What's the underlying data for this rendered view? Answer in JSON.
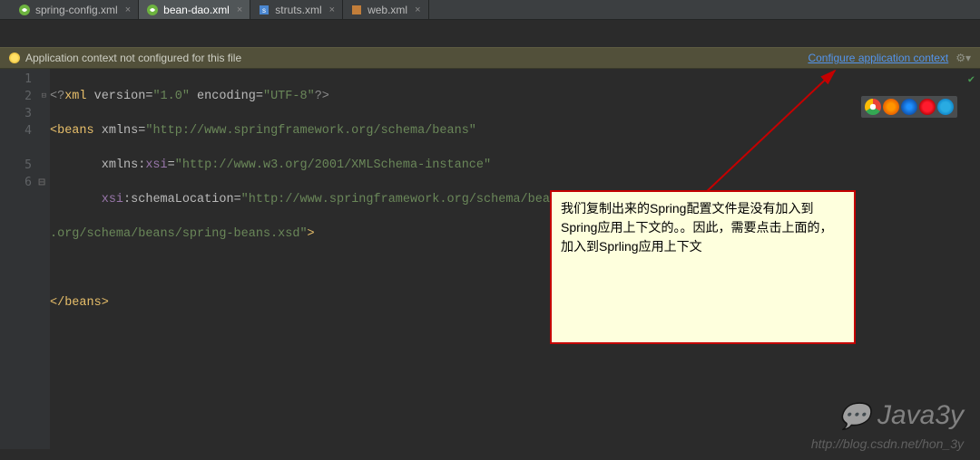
{
  "tabs": [
    {
      "label": "spring-config.xml",
      "active": false,
      "icon": "spring"
    },
    {
      "label": "bean-dao.xml",
      "active": true,
      "icon": "spring"
    },
    {
      "label": "struts.xml",
      "active": false,
      "icon": "struts"
    },
    {
      "label": "web.xml",
      "active": false,
      "icon": "xml"
    }
  ],
  "banner": {
    "message": "Application context not configured for this file",
    "link": "Configure application context"
  },
  "gutter": {
    "lines": [
      "1",
      "2",
      "3",
      "4",
      "",
      "5",
      "6"
    ]
  },
  "code": {
    "l1_pi_open": "<?",
    "l1_pi_name": "xml ",
    "l1_attr1": "version",
    "l1_eq": "=",
    "l1_val1": "\"1.0\"",
    "l1_attr2": " encoding",
    "l1_val2": "\"UTF-8\"",
    "l1_pi_close": "?>",
    "l2_open": "<",
    "l2_tag": "beans ",
    "l2_attr": "xmlns",
    "l2_val": "\"http://www.springframework.org/schema/beans\"",
    "l3_indent": "       ",
    "l3_attr": "xmlns:",
    "l3_ns": "xsi",
    "l3_val": "\"http://www.w3.org/2001/XMLSchema-instance\"",
    "l4_indent": "       ",
    "l4_ns": "xsi",
    "l4_colon": ":",
    "l4_attr": "schemaLocation",
    "l4_val": "\"http://www.springframework.org/schema/beans http://www.springframework",
    "l4b_val": ".org/schema/beans/spring-beans.xsd\"",
    "l4b_close": ">",
    "l6_open": "</",
    "l6_tag": "beans",
    "l6_close": ">"
  },
  "callout": {
    "text": "我们复制出来的Spring配置文件是没有加入到Spring应用上下文的。。因此，需要点击上面的，加入到Sprling应用上下文"
  },
  "watermark": {
    "name": "Java3y",
    "url": "http://blog.csdn.net/hon_3y"
  },
  "browser_icons": [
    "chrome",
    "firefox",
    "safari",
    "opera",
    "ie"
  ]
}
